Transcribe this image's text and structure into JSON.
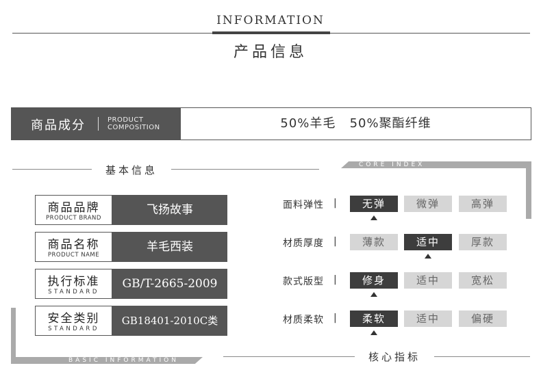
{
  "header": {
    "title_en": "INFORMATION",
    "title_cn": "产品信息"
  },
  "composition": {
    "label_cn": "商品成分",
    "label_en_line1": "PRODUCT",
    "label_en_line2": "COMPOSITION",
    "value": "50%羊毛   50%聚酯纤维"
  },
  "basic_info": {
    "title": "基本信息",
    "frame_label": "BASIC INFORMATION",
    "rows": [
      {
        "label_cn": "商品品牌",
        "label_en": "PRODUCT BRAND",
        "value": "飞扬故事"
      },
      {
        "label_cn": "商品名称",
        "label_en": "PRODUCT NAME",
        "value": "羊毛西装"
      },
      {
        "label_cn": "执行标准",
        "label_en": "STANDARD",
        "value": "GB/T-2665-2009"
      },
      {
        "label_cn": "安全类别",
        "label_en": "STANDARD",
        "value": "GB18401-2010C类"
      }
    ]
  },
  "core_index": {
    "title": "核心指标",
    "frame_label": "CORE INDEX",
    "rows": [
      {
        "label": "面料弹性",
        "pipe": "|",
        "options": [
          "无弹",
          "微弹",
          "高弹"
        ],
        "selected": 0
      },
      {
        "label": "材质厚度",
        "pipe": "|",
        "options": [
          "薄款",
          "适中",
          "厚款"
        ],
        "selected": 1
      },
      {
        "label": "款式版型",
        "pipe": "|",
        "options": [
          "修身",
          "适中",
          "宽松"
        ],
        "selected": 0
      },
      {
        "label": "材质柔软",
        "pipe": "|",
        "options": [
          "柔软",
          "适中",
          "偏硬"
        ],
        "selected": 0
      }
    ]
  },
  "colors": {
    "dark": "#555555",
    "selected": "#3d3d3d",
    "unselected": "#d6d6d6",
    "frame": "#aaaaaa"
  }
}
